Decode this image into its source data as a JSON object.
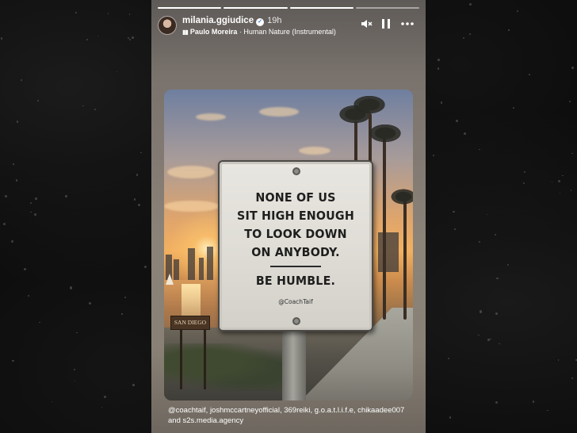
{
  "story": {
    "progress": {
      "total_segments": 4,
      "completed_segments": 3
    },
    "header": {
      "username": "milania.ggiudice",
      "verified": true,
      "posted_ago": "19h",
      "music_artist": "Paulo Moreira",
      "music_separator": "·",
      "music_title": "Human Nature (Instrumental)"
    },
    "controls": {
      "mute_icon": "speaker-muted-icon",
      "pause_icon": "pause-icon",
      "more_icon": "more-options-icon"
    },
    "photo": {
      "sign_lines": [
        "NONE OF US",
        "SIT HIGH ENOUGH",
        "TO LOOK DOWN",
        "ON ANYBODY."
      ],
      "sign_tagline": "BE HUMBLE.",
      "sign_credit": "@CoachTaif",
      "place_sign": "SAN DIEGO"
    },
    "caption": {
      "mentions": "@coachtaif, joshmccartneyofficial, 369reiki, g.o.a.t.l.i.f.e, chikaadee007",
      "conjunction": "and",
      "last_mention": "s2s.media.agency"
    }
  },
  "colors": {
    "background": "#0a0a0a",
    "story_panel": "#8b8278",
    "sign_face": "#e4e2dc",
    "sunset": "#f2b060"
  }
}
